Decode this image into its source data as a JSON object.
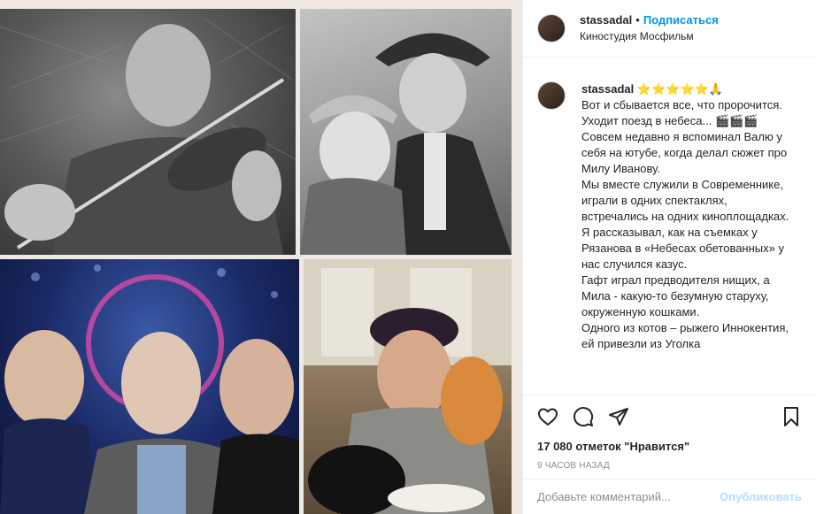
{
  "header": {
    "username": "stassadal",
    "separator": "•",
    "follow_label": "Подписаться",
    "location": "Киностудия Мосфильм"
  },
  "caption": {
    "username": "stassadal",
    "emojis": "⭐⭐⭐⭐⭐🙏",
    "lines": [
      "Вот и сбывается все, что пророчится. Уходит поезд в небеса... 🎬🎬🎬",
      "Совсем недавно я вспоминал Валю у себя на ютубе, когда делал сюжет про Милу Иванову.",
      "Мы вместе служили в Современнике, играли в одних спектаклях, встречались на одних киноплощадках.",
      "Я рассказывал, как на съемках у Рязанова в «Небесах обетованных» у нас случился казус.",
      "Гафт играл предводителя нищих, а Мила - какую-то безумную старуху, окруженную кошками.",
      "Одного из котов – рыжего Иннокентия, ей привезли из Уголка"
    ]
  },
  "actions": {
    "like_icon": "heart-icon",
    "comment_icon": "speech-bubble-icon",
    "share_icon": "paper-plane-icon",
    "save_icon": "bookmark-icon"
  },
  "likes_text": "17 080 отметок \"Нравится\"",
  "time_text": "9 ЧАСОВ НАЗАД",
  "comment_box": {
    "placeholder": "Добавьте комментарий...",
    "publish_label": "Опубликовать"
  },
  "colors": {
    "accent": "#0095f6",
    "publish_disabled": "#b2dffc",
    "muted": "#8e8e8e"
  }
}
